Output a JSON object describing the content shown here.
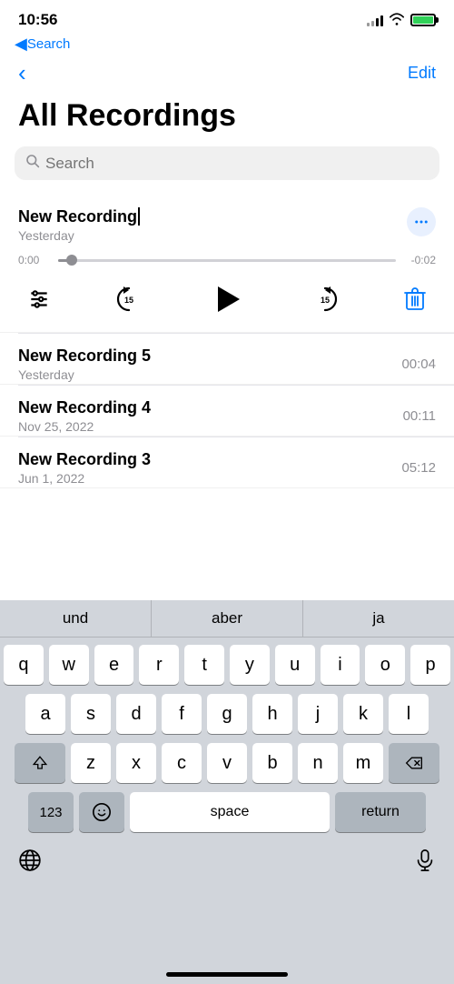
{
  "statusBar": {
    "time": "10:56",
    "backLabel": "Search"
  },
  "nav": {
    "backIcon": "‹",
    "editLabel": "Edit",
    "title": "All Recordings"
  },
  "search": {
    "placeholder": "Search"
  },
  "recordings": [
    {
      "id": "r1",
      "name": "New Recording",
      "date": "Yesterday",
      "duration": null,
      "expanded": true,
      "progress": {
        "current": "0:00",
        "remaining": "-0:02"
      }
    },
    {
      "id": "r2",
      "name": "New Recording 5",
      "date": "Yesterday",
      "duration": "00:04",
      "expanded": false
    },
    {
      "id": "r3",
      "name": "New Recording 4",
      "date": "Nov 25, 2022",
      "duration": "00:11",
      "expanded": false
    },
    {
      "id": "r4",
      "name": "New Recording 3",
      "date": "Jun 1, 2022",
      "duration": "05:12",
      "expanded": false
    }
  ],
  "player": {
    "skipBack": "15",
    "skipForward": "15"
  },
  "autocomplete": {
    "items": [
      "und",
      "aber",
      "ja"
    ]
  },
  "keyboard": {
    "rows": [
      [
        "q",
        "w",
        "e",
        "r",
        "t",
        "y",
        "u",
        "i",
        "o",
        "p"
      ],
      [
        "a",
        "s",
        "d",
        "f",
        "g",
        "h",
        "j",
        "k",
        "l"
      ],
      [
        "z",
        "x",
        "c",
        "v",
        "b",
        "n",
        "m"
      ]
    ],
    "spaceLabel": "space",
    "returnLabel": "return",
    "numLabel": "123",
    "globeIcon": "🌐",
    "micIcon": "🎤"
  }
}
